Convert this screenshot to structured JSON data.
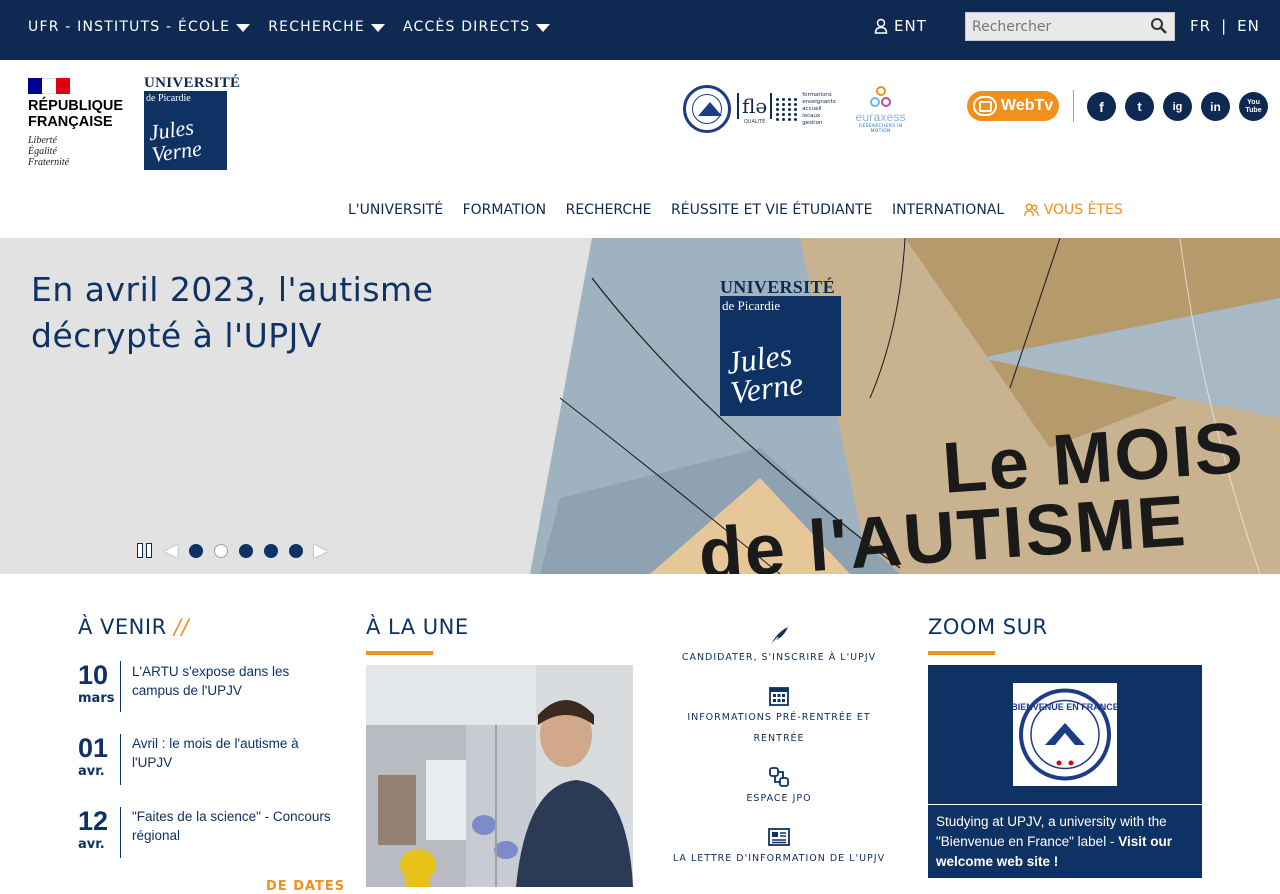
{
  "topbar": {
    "nav": [
      {
        "label": "UFR - INSTITUTS - ÉCOLE"
      },
      {
        "label": "RECHERCHE"
      },
      {
        "label": "ACCÈS DIRECTS"
      }
    ],
    "ent_label": "ENT",
    "search_placeholder": "Rechercher",
    "lang_fr": "FR",
    "lang_sep": "|",
    "lang_en": "EN"
  },
  "header": {
    "rf_title_1": "RÉPUBLIQUE",
    "rf_title_2": "FRANÇAISE",
    "rf_motto_1": "Liberté",
    "rf_motto_2": "Égalité",
    "rf_motto_3": "Fraternité",
    "upjv_word": "UNIVERSITÉ",
    "upjv_de": "de Picardie",
    "upjv_name": "Jules Verne",
    "fle_mark": "flə",
    "fle_quality": "QUALITÉ",
    "fle_lines": [
      "formations",
      "enseignants",
      "accueil",
      "locaux",
      "gestion"
    ],
    "euraxess": "euraxess",
    "euraxess_sub": "RESEARCHERS IN MOTION",
    "webtv_label": "WebTv",
    "social": [
      "f",
      "t",
      "ig",
      "in",
      "You Tube"
    ]
  },
  "mainnav": [
    {
      "label": "L'UNIVERSITÉ"
    },
    {
      "label": "FORMATION"
    },
    {
      "label": "RECHERCHE"
    },
    {
      "label": "RÉUSSITE ET VIE ÉTUDIANTE"
    },
    {
      "label": "INTERNATIONAL"
    },
    {
      "label": "VOUS ÊTES"
    }
  ],
  "hero": {
    "title": "En avril 2023, l'autisme décrypté à l'UPJV",
    "big_line_1": "Le MOIS",
    "big_line_2": "de l'AUTISME",
    "logo_word": "UNIVERSITÉ",
    "logo_de": "de Picardie",
    "logo_name": "Jules Verne",
    "slides_total": 5,
    "active_slide": 2
  },
  "avenir": {
    "heading": "À VENIR",
    "slashes": "//",
    "events": [
      {
        "day": "10",
        "month": "mars",
        "title": "L'ARTU s'expose dans les campus de l'UPJV"
      },
      {
        "day": "01",
        "month": "avr.",
        "title": "Avril : le mois de l'autisme à l'UPJV"
      },
      {
        "day": "12",
        "month": "avr.",
        "title": "\"Faites de la science\" - Concours régional"
      }
    ],
    "more_label": "DE DATES"
  },
  "une": {
    "heading": "À LA UNE"
  },
  "quicklinks": [
    {
      "icon": "quill-icon",
      "label": "CANDIDATER, S'INSCRIRE À L'UPJV"
    },
    {
      "icon": "calendar-icon",
      "label": "INFORMATIONS PRÉ-RENTRÉE ET RENTRÉE"
    },
    {
      "icon": "open-day-icon",
      "label": "ESPACE JPO"
    },
    {
      "icon": "newsletter-icon",
      "label": "LA LETTRE D'INFORMATION DE L'UPJV"
    }
  ],
  "zoom": {
    "heading": "ZOOM SUR",
    "badge_text": "BIENVENUE EN FRANCE",
    "text_plain": "Studying at UPJV, a university with the \"Bienvenue en France\" label - ",
    "text_bold": "Visit our welcome web site !"
  },
  "colors": {
    "navy": "#0f2a52",
    "accent": "#f0901e",
    "title_blue": "#0f3264"
  }
}
